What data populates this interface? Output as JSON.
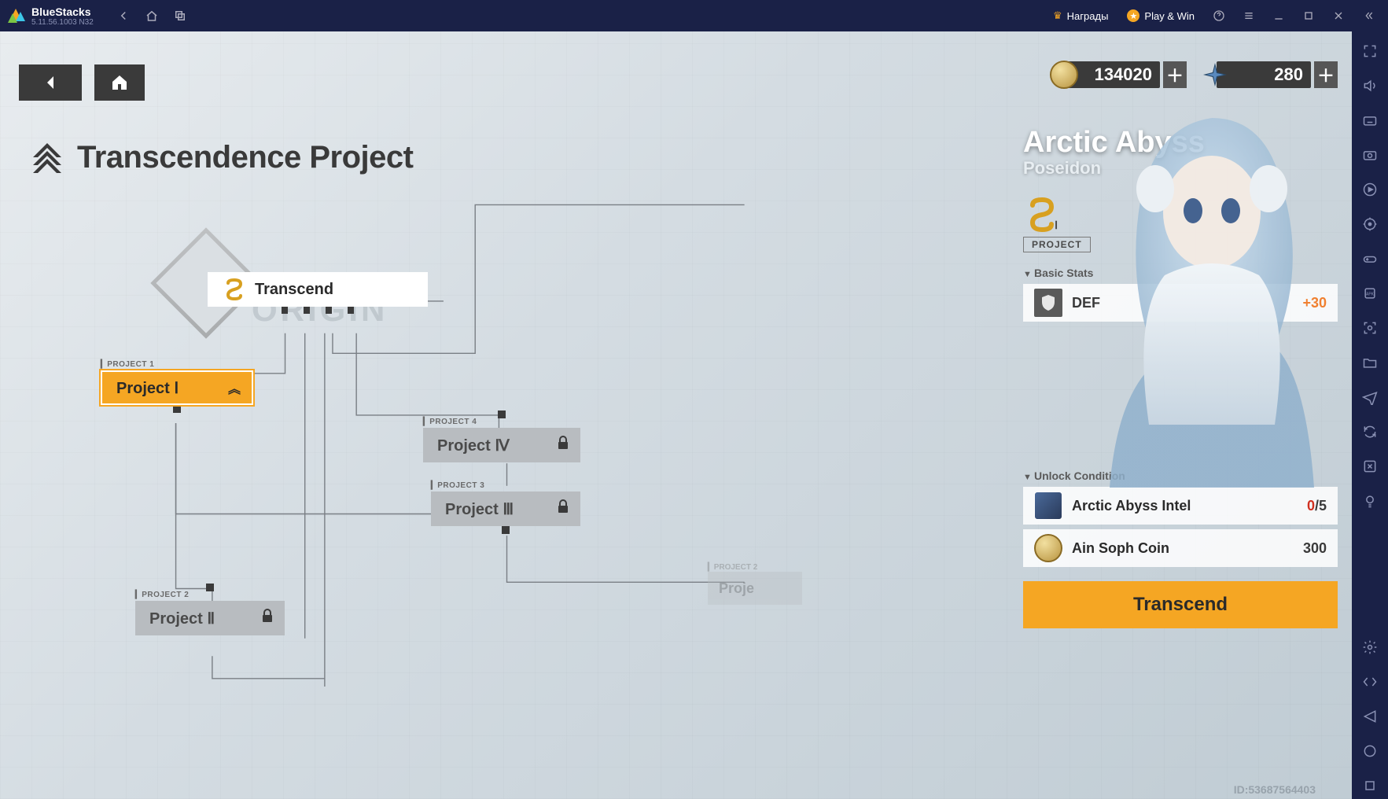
{
  "bluestacks": {
    "title": "BlueStacks",
    "version": "5.11.56.1003  N32",
    "rewards_label": "Награды",
    "playwin_label": "Play & Win"
  },
  "currencies": {
    "coin": "134020",
    "crystal": "280"
  },
  "page_title": "Transcendence Project",
  "origin_word": "ORIGIN",
  "nodes": {
    "transcend": {
      "label": "Transcend"
    },
    "p1": {
      "tag": "▎PROJECT 1",
      "label": "Project Ⅰ"
    },
    "p2": {
      "tag": "▎PROJECT 2",
      "label": "Project Ⅱ"
    },
    "p3": {
      "tag": "▎PROJECT 3",
      "label": "Project Ⅲ"
    },
    "p4": {
      "tag": "▎PROJECT 4",
      "label": "Project Ⅳ"
    },
    "ghost_tag": "▎PROJECT 2",
    "ghost_label": "Proje"
  },
  "character": {
    "name": "Arctic Abyss",
    "subtitle": "Poseidon",
    "rank_suffix": "Ⅰ",
    "project_label": "PROJECT"
  },
  "stats": {
    "header": "Basic Stats",
    "def_label": "DEF",
    "def_value": "+30"
  },
  "unlock": {
    "header": "Unlock Condition",
    "intel_label": "Arctic Abyss Intel",
    "intel_have": "0",
    "intel_need": "/5",
    "coin_label": "Ain Soph Coin",
    "coin_value": "300"
  },
  "action_button": "Transcend",
  "footer_id": "ID:53687564403"
}
